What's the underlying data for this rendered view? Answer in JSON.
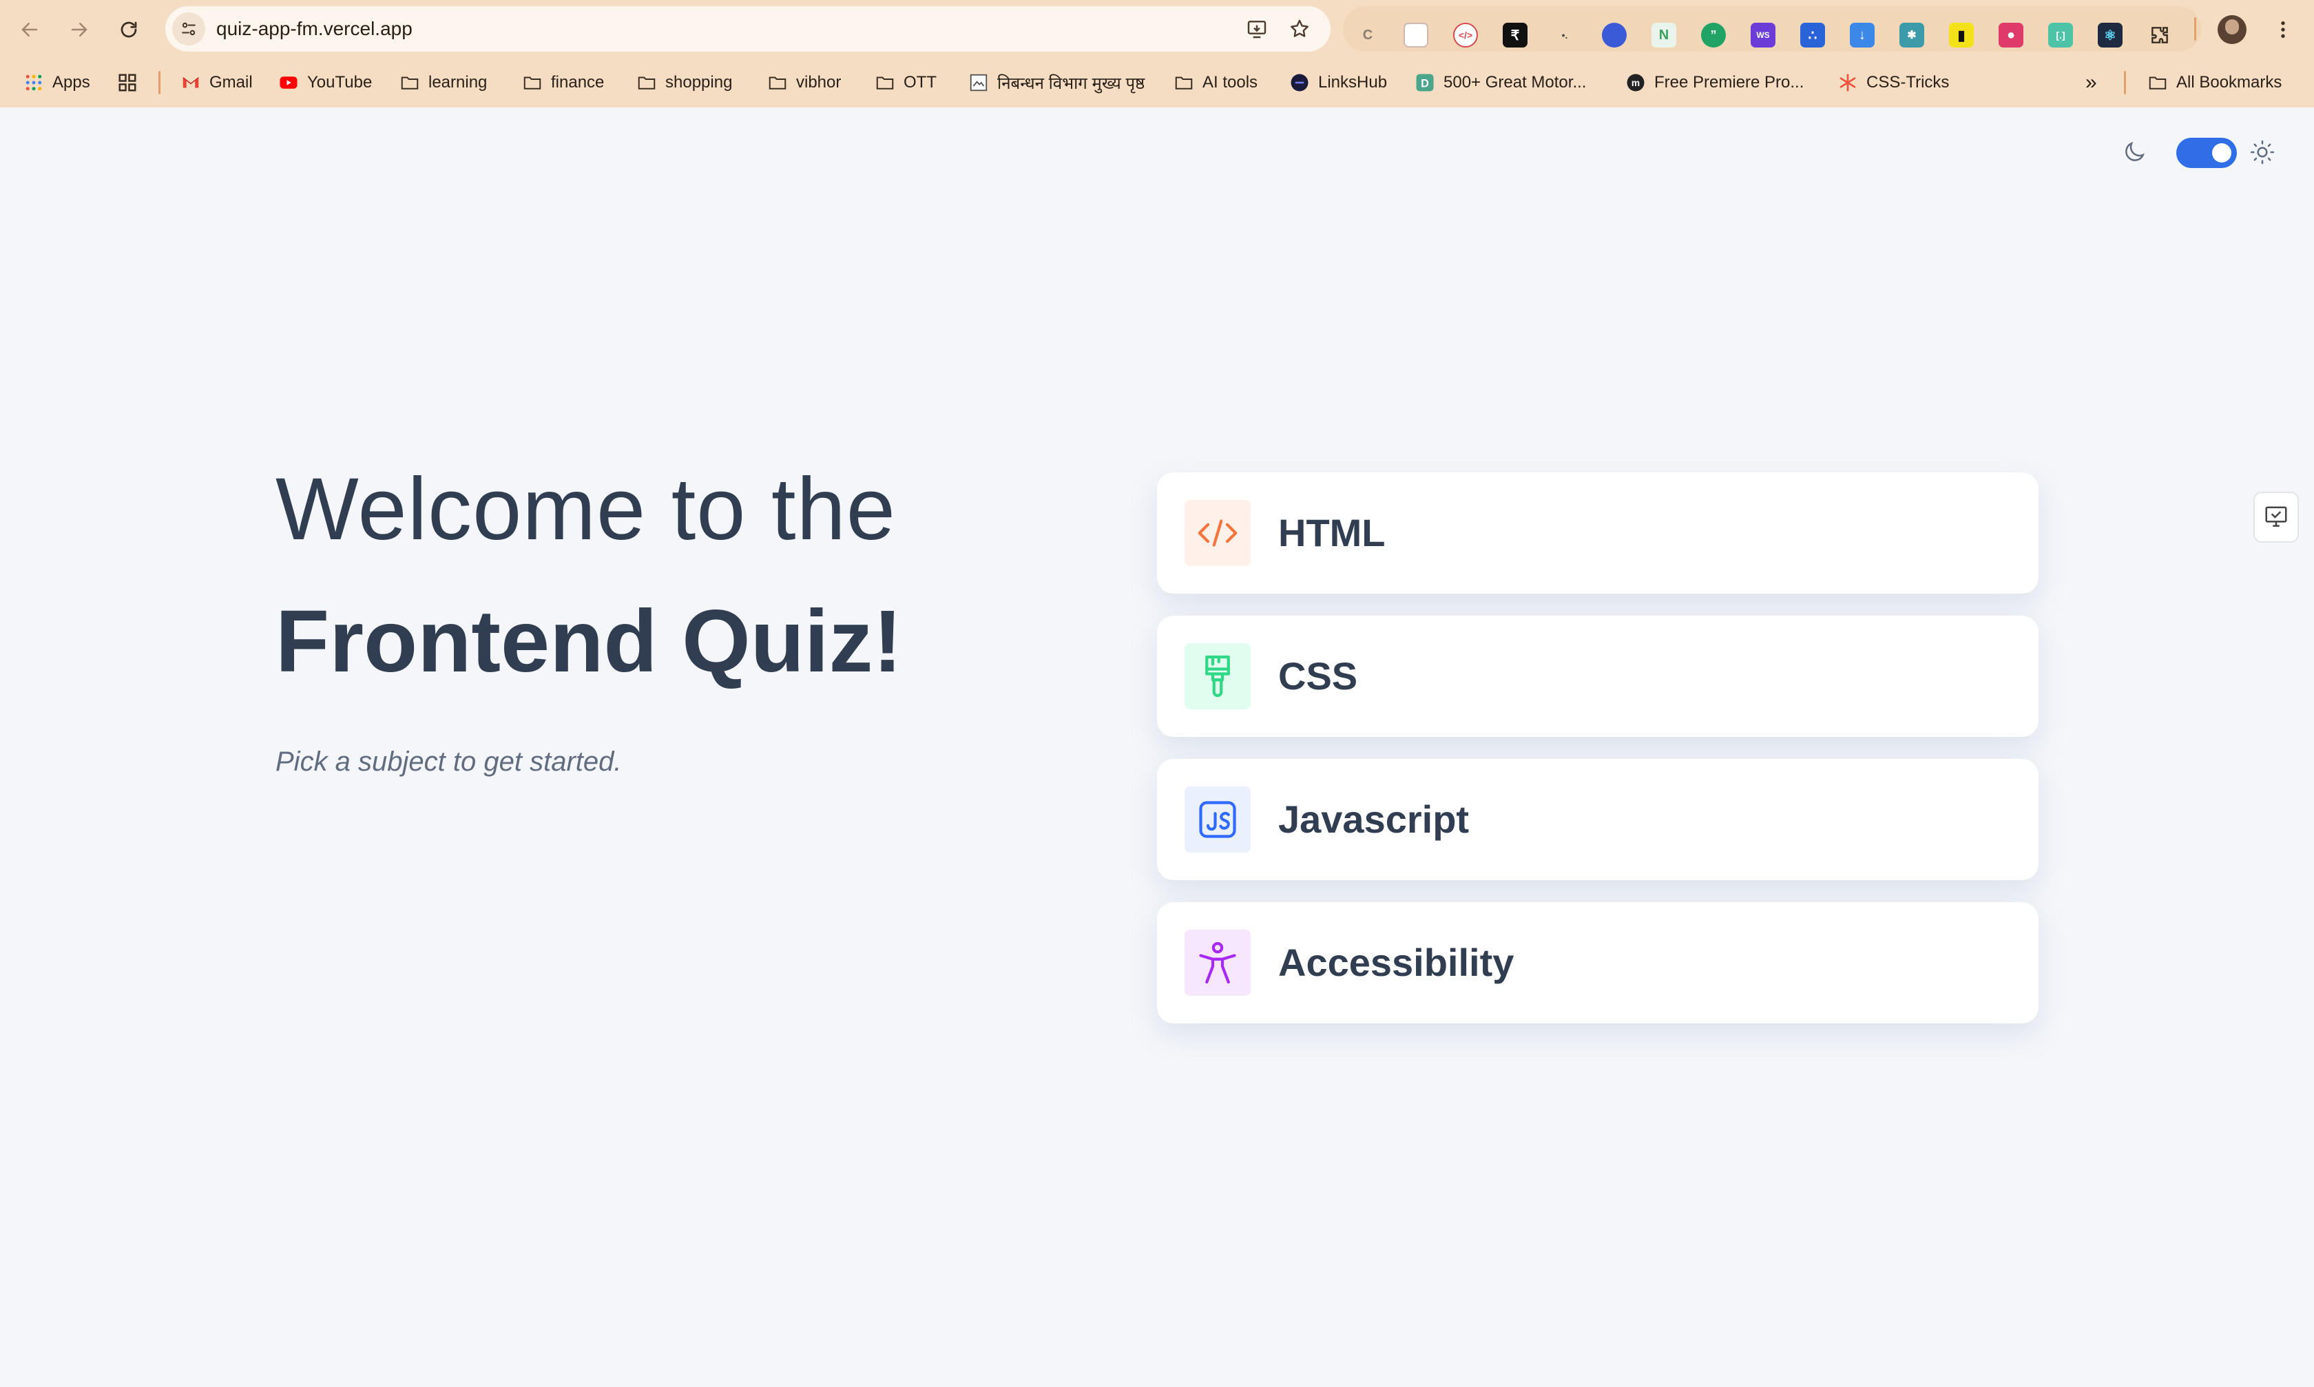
{
  "browser": {
    "url": "quiz-app-fm.vercel.app",
    "bookmarks": [
      {
        "label": "Apps",
        "icon": "apps-grid-icon"
      },
      {
        "label": "",
        "icon": "grid-icon"
      },
      {
        "label": "Gmail",
        "icon": "gmail-icon"
      },
      {
        "label": "YouTube",
        "icon": "youtube-icon"
      },
      {
        "label": "learning",
        "icon": "folder-icon"
      },
      {
        "label": "finance",
        "icon": "folder-icon"
      },
      {
        "label": "shopping",
        "icon": "folder-icon"
      },
      {
        "label": "vibhor",
        "icon": "folder-icon"
      },
      {
        "label": "OTT",
        "icon": "folder-icon"
      },
      {
        "label": "निबन्धन विभाग मुख्य पृष्ठ",
        "icon": "site-icon"
      },
      {
        "label": "AI tools",
        "icon": "folder-icon"
      },
      {
        "label": "LinksHub",
        "icon": "site-icon"
      },
      {
        "label": "500+ Great Motor...",
        "icon": "site-icon"
      },
      {
        "label": "Free Premiere Pro...",
        "icon": "site-icon"
      },
      {
        "label": "CSS-Tricks",
        "icon": "site-icon"
      }
    ],
    "all_bookmarks_label": "All Bookmarks",
    "more_bookmarks_label": "»"
  },
  "page": {
    "title_line1": "Welcome to the",
    "title_line2": "Frontend Quiz!",
    "subtitle": "Pick a subject to get started.",
    "theme_toggle": {
      "dark_mode_enabled": true
    },
    "subjects": [
      {
        "label": "HTML",
        "icon": "html-code-icon",
        "icon_bg": "#fff1e9",
        "icon_color": "#f6753f"
      },
      {
        "label": "CSS",
        "icon": "paintbrush-icon",
        "icon_bg": "#e0fdef",
        "icon_color": "#2fd887"
      },
      {
        "label": "Javascript",
        "icon": "js-icon",
        "icon_bg": "#ebf0ff",
        "icon_color": "#306aff"
      },
      {
        "label": "Accessibility",
        "icon": "accessibility-icon",
        "icon_bg": "#f6e7ff",
        "icon_color": "#a729f5"
      }
    ]
  },
  "colors": {
    "chrome_bg": "#f5ddc3",
    "page_bg": "#f4f6fa",
    "text_dark": "#313e51",
    "text_muted": "#626c7f",
    "toggle_accent": "#2f6ee6"
  }
}
